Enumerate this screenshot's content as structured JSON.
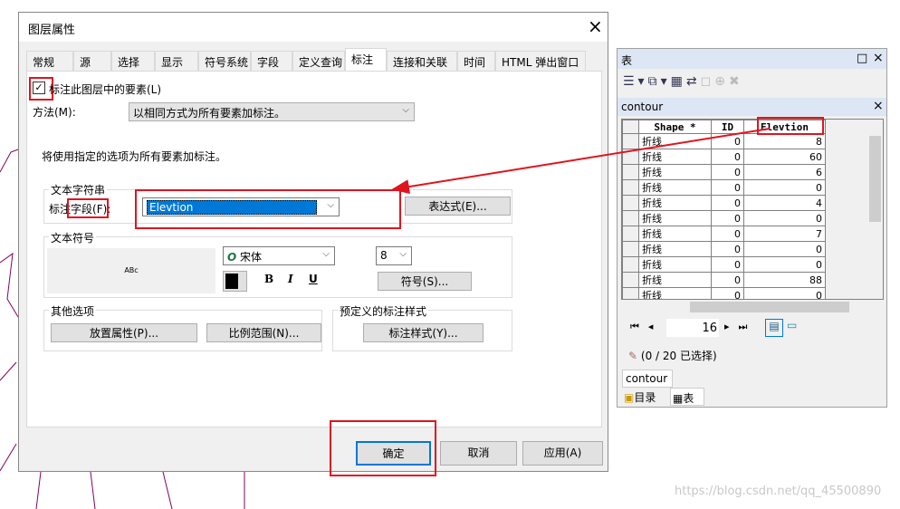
{
  "dialog": {
    "title": "图层属性",
    "close": "×",
    "tabs": [
      "常规",
      "源",
      "选择",
      "显示",
      "符号系统",
      "字段",
      "定义查询",
      "标注",
      "连接和关联",
      "时间",
      "HTML 弹出窗口"
    ],
    "active_tab": "标注",
    "label_checkbox": {
      "label": "标注此图层中的要素(L)",
      "checked": true
    },
    "method_label": "方法(M):",
    "method_value": "以相同方式为所有要素加标注。",
    "info_text": "将使用指定的选项为所有要素加标注。",
    "text_string": {
      "group": "文本字符串",
      "field_label_a": "标注",
      "field_label_b": "字段(F):",
      "field_value": "Elevtion",
      "expression_button": "表达式(E)..."
    },
    "text_symbol": {
      "group": "文本符号",
      "preview": "ABc",
      "font": "宋体",
      "size": "8",
      "bold": "B",
      "italic": "I",
      "underline": "U",
      "symbol_button": "符号(S)...",
      "color": "#000000"
    },
    "other_options": {
      "group": "其他选项",
      "placement_button": "放置属性(P)...",
      "scale_button": "比例范围(N)..."
    },
    "predefined": {
      "group": "预定义的标注样式",
      "style_button": "标注样式(Y)..."
    },
    "ok": "确定",
    "cancel": "取消",
    "apply": "应用(A)"
  },
  "table_window": {
    "title": "表",
    "layer_tab": "contour",
    "columns": [
      "Shape *",
      "ID",
      "Elevtion"
    ],
    "rows": [
      [
        "折线",
        "0",
        "8"
      ],
      [
        "折线",
        "0",
        "60"
      ],
      [
        "折线",
        "0",
        "6"
      ],
      [
        "折线",
        "0",
        "0"
      ],
      [
        "折线",
        "0",
        "4"
      ],
      [
        "折线",
        "0",
        "0"
      ],
      [
        "折线",
        "0",
        "7"
      ],
      [
        "折线",
        "0",
        "0"
      ],
      [
        "折线",
        "0",
        "0"
      ],
      [
        "折线",
        "0",
        "88"
      ],
      [
        "折线",
        "0",
        "0"
      ],
      [
        "折线",
        "0",
        "0"
      ]
    ],
    "record": "16",
    "selection_status": "(0 / 20 已选择)",
    "bottom_tab": "contour",
    "toc_tab": "目录",
    "table_tab": "表"
  },
  "watermark": "https://blog.csdn.net/qq_45500890",
  "colors": {
    "annotation": "#e0141e",
    "highlight": "#0078d7"
  }
}
